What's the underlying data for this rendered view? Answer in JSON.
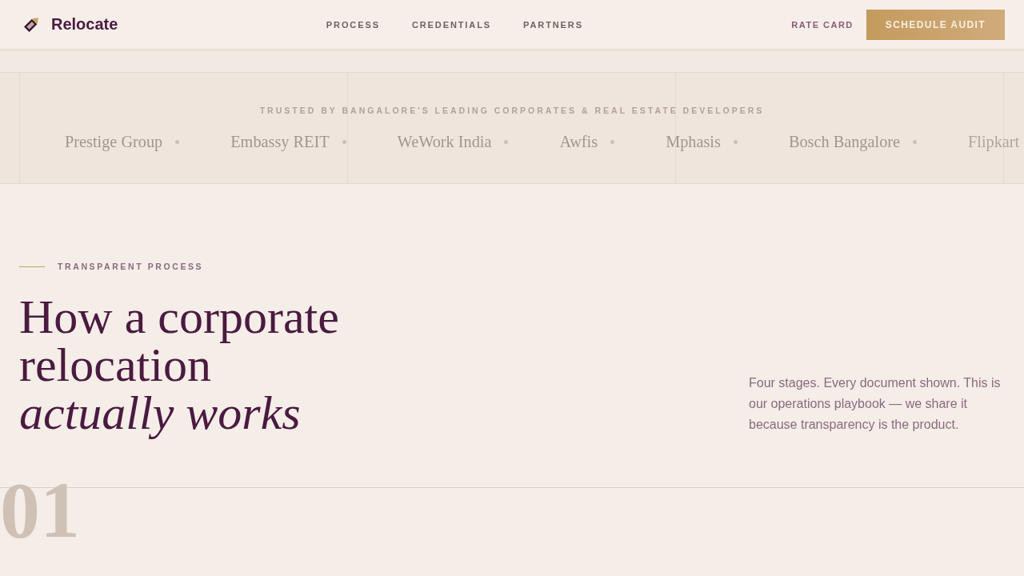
{
  "header": {
    "brand": "Relocate",
    "nav": [
      {
        "label": "PROCESS"
      },
      {
        "label": "CREDENTIALS"
      },
      {
        "label": "PARTNERS"
      }
    ],
    "secondary_link": "RATE CARD",
    "cta_button": "SCHEDULE AUDIT"
  },
  "trusted_band": {
    "label": "TRUSTED BY BANGALORE'S LEADING CORPORATES & REAL ESTATE DEVELOPERS",
    "clients": [
      "Prestige Group",
      "Embassy REIT",
      "WeWork India",
      "Awfis",
      "Mphasis",
      "Bosch Bangalore",
      "Flipkart"
    ]
  },
  "process_section": {
    "eyebrow": "TRANSPARENT PROCESS",
    "heading": "How a corporate relocation *actually works*",
    "intro": "Four stages. Every document shown. This is our operations playbook — we share it because transparency is the product.",
    "step_number": "01"
  }
}
